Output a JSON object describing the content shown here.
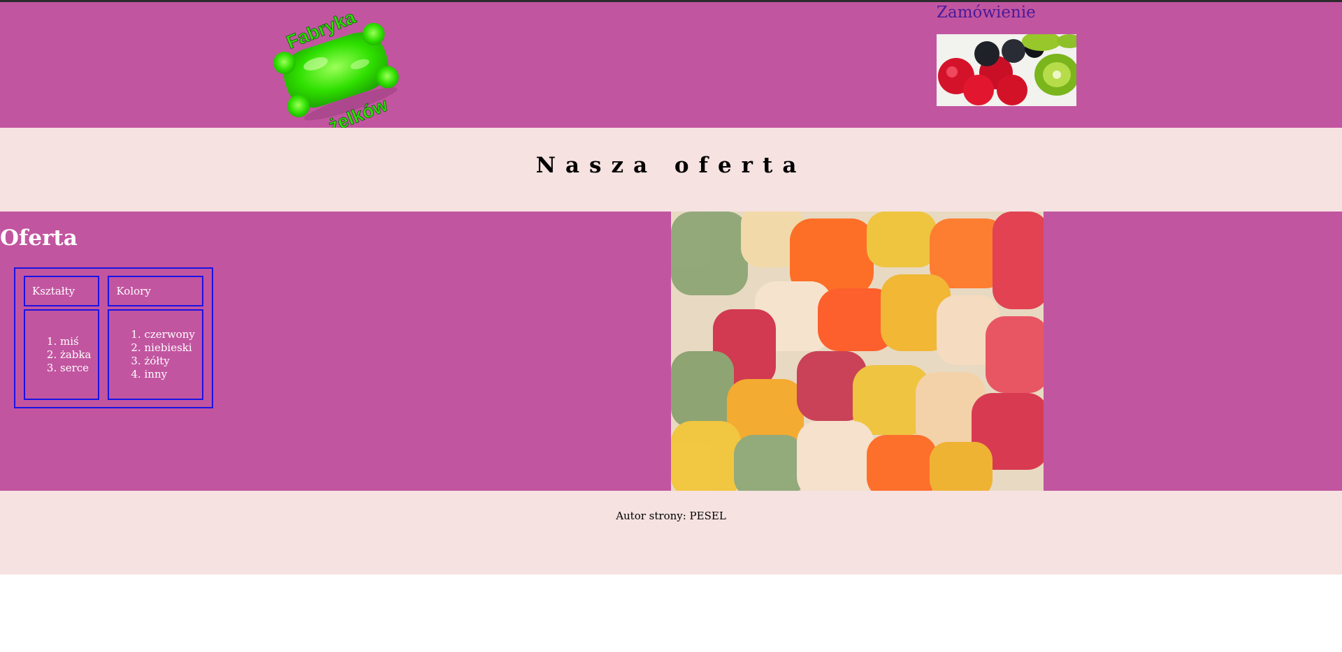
{
  "header": {
    "logo_line1": "Fabryka",
    "logo_line2": "żelków",
    "order_link": "Zamówienie"
  },
  "band": {
    "title": "Nasza oferta"
  },
  "main": {
    "title": "Oferta",
    "table": {
      "headers": [
        "Kształty",
        "Kolory"
      ],
      "shapes": [
        "miś",
        "żabka",
        "serce"
      ],
      "colors": [
        "czerwony",
        "niebieski",
        "żółty",
        "inny"
      ]
    }
  },
  "footer": {
    "author": "Autor strony: PESEL"
  },
  "colors": {
    "header_bg": "#c255a0",
    "band_bg": "#f5e2e1",
    "table_border": "#1a12e6",
    "link": "#4a1a9a"
  }
}
